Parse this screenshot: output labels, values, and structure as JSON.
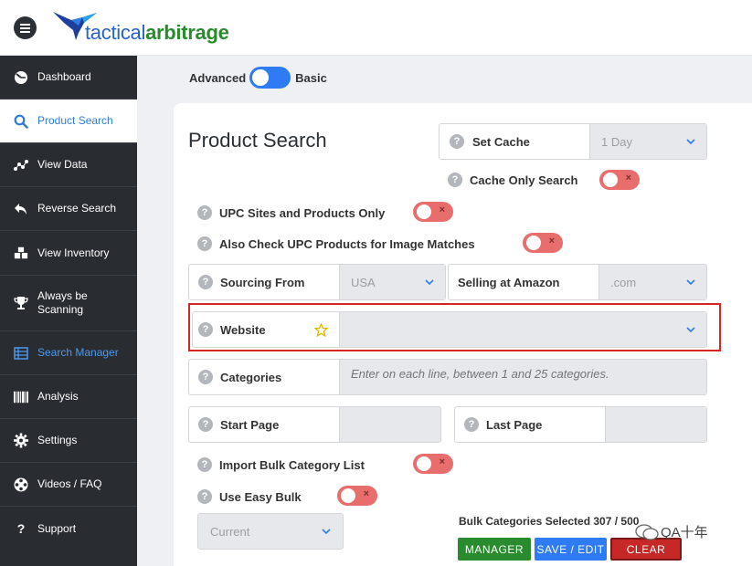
{
  "brand": {
    "name_part1": "tactical",
    "name_part2": "arbitrage"
  },
  "sidebar": {
    "items": [
      {
        "label": "Dashboard",
        "icon": "dashboard-icon"
      },
      {
        "label": "Product Search",
        "icon": "search-icon"
      },
      {
        "label": "View Data",
        "icon": "scatter-icon"
      },
      {
        "label": "Reverse Search",
        "icon": "reply-arrow-icon"
      },
      {
        "label": "View Inventory",
        "icon": "boxes-icon"
      },
      {
        "label": "Always be Scanning",
        "icon": "trophy-icon"
      },
      {
        "label": "Search Manager",
        "icon": "list-icon"
      },
      {
        "label": "Analysis",
        "icon": "barcode-icon"
      },
      {
        "label": "Settings",
        "icon": "gear-icon"
      },
      {
        "label": "Videos / FAQ",
        "icon": "film-reel-icon"
      },
      {
        "label": "Support",
        "icon": "question-icon"
      }
    ]
  },
  "mode_toggle": {
    "left_label": "Advanced",
    "right_label": "Basic"
  },
  "page_title": "Product Search",
  "set_cache": {
    "label": "Set Cache",
    "value": "1 Day"
  },
  "cache_only": {
    "label": "Cache Only Search"
  },
  "upc_only": {
    "label": "UPC Sites and Products Only"
  },
  "upc_image": {
    "label": "Also Check UPC Products for Image Matches"
  },
  "sourcing": {
    "label": "Sourcing From",
    "value": "USA"
  },
  "selling": {
    "label": "Selling at Amazon",
    "value": ".com"
  },
  "website": {
    "label": "Website",
    "value": ""
  },
  "categories": {
    "label": "Categories",
    "placeholder": "Enter on each line, between 1 and 25 categories."
  },
  "start_page": {
    "label": "Start Page",
    "value": ""
  },
  "last_page": {
    "label": "Last Page",
    "value": ""
  },
  "import_bulk": {
    "label": "Import Bulk Category List"
  },
  "easy_bulk": {
    "label": "Use Easy Bulk",
    "value": "Current"
  },
  "bulk_summary": "Bulk Categories Selected 307 / 500",
  "buttons": {
    "manager": "MANAGER",
    "save_edit": "SAVE / EDIT",
    "clear": "CLEAR"
  },
  "watermark": "QA十年",
  "toggle_marker": "×",
  "help_marker": "?",
  "colors": {
    "accent_blue": "#2e7bf3",
    "sidebar_bg": "#292c31",
    "toggle_off_red": "#e86d6d",
    "manager_green": "#2a8a2e",
    "clear_red": "#c62828"
  }
}
